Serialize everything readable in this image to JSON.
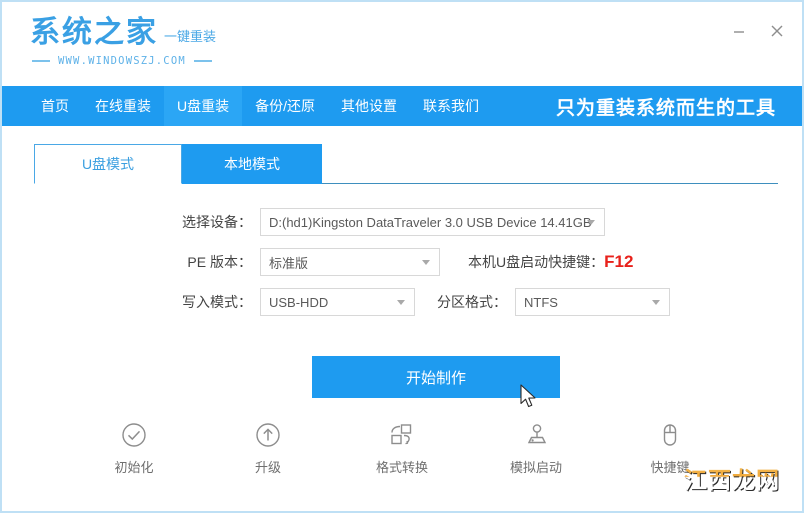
{
  "window": {
    "minimize_label": "−",
    "close_label": "×",
    "minimize_icon": "minimize-icon",
    "close_icon": "close-icon"
  },
  "brand": {
    "title": "系统之家",
    "subtitle": "一键重装",
    "url": "WWW.WINDOWSZJ.COM"
  },
  "nav": {
    "items": [
      {
        "label": "首页",
        "active": false
      },
      {
        "label": "在线重装",
        "active": false
      },
      {
        "label": "U盘重装",
        "active": true
      },
      {
        "label": "备份/还原",
        "active": false
      },
      {
        "label": "其他设置",
        "active": false
      },
      {
        "label": "联系我们",
        "active": false
      }
    ],
    "slogan": "只为重装系统而生的工具"
  },
  "tabs": [
    {
      "label": "U盘模式",
      "active": true
    },
    {
      "label": "本地模式",
      "active": false
    }
  ],
  "form": {
    "device": {
      "label": "选择设备：",
      "value": "D:(hd1)Kingston DataTraveler 3.0 USB Device 14.41GB"
    },
    "pe_version": {
      "label": "PE 版本：",
      "value": "标准版"
    },
    "hotkey": {
      "label": "本机U盘启动快捷键：",
      "value": "F12"
    },
    "write_mode": {
      "label": "写入模式：",
      "value": "USB-HDD"
    },
    "partition_format": {
      "label": "分区格式：",
      "value": "NTFS"
    }
  },
  "start_button": {
    "label": "开始制作"
  },
  "tools": [
    {
      "label": "初始化",
      "icon": "check-circle-icon"
    },
    {
      "label": "升级",
      "icon": "arrow-up-circle-icon"
    },
    {
      "label": "格式转换",
      "icon": "format-convert-icon"
    },
    {
      "label": "模拟启动",
      "icon": "joystick-icon"
    },
    {
      "label": "快捷键",
      "icon": "mouse-icon"
    }
  ],
  "watermark": {
    "text": "江西龙网"
  },
  "colors": {
    "accent": "#1e9bf0",
    "nav_active": "#2ba6f5",
    "hotkey": "#e8211b",
    "border": "#bfe0f5",
    "tab_border": "#4aa8e6"
  }
}
